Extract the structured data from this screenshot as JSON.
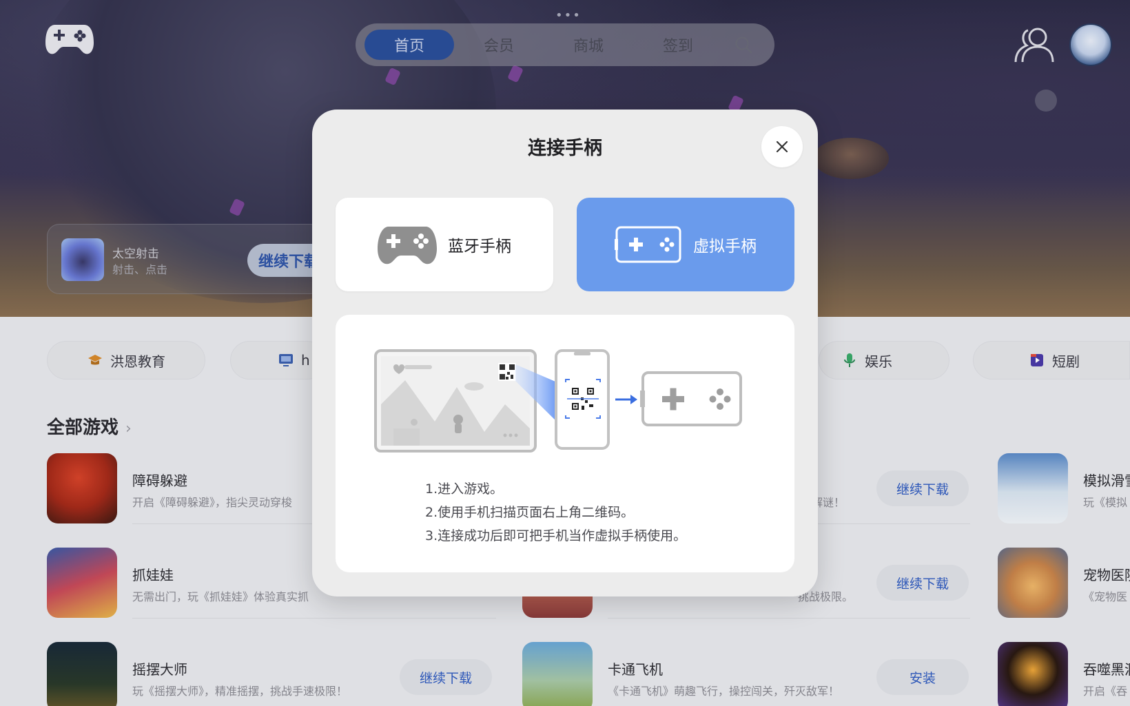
{
  "topbar": {
    "drag_handle": "•••",
    "tabs": [
      {
        "label": "首页",
        "active": true
      },
      {
        "label": "会员",
        "active": false
      },
      {
        "label": "商城",
        "active": false
      },
      {
        "label": "签到",
        "active": false
      }
    ],
    "icons": [
      "gamepad-logo-icon",
      "search-icon",
      "user-group-icon",
      "avatar"
    ]
  },
  "continue_card": {
    "title": "太空射击",
    "subtitle": "射击、点击",
    "button": "继续下载"
  },
  "categories": [
    {
      "label": "洪恩教育",
      "icon": "graduation-cap-icon"
    },
    {
      "label": "h",
      "icon": "monitor-icon"
    },
    {
      "label": "娱乐",
      "icon": "microphone-icon"
    },
    {
      "label": "短剧",
      "icon": "video-icon"
    }
  ],
  "section": {
    "title": "全部游戏",
    "chevron": "›"
  },
  "games_left": [
    {
      "name": "障碍躲避",
      "desc": "开启《障碍躲避》，指尖灵动穿梭"
    },
    {
      "name": "抓娃娃",
      "desc": "无需出门，玩《抓娃娃》体验真实抓"
    },
    {
      "name": "摇摆大师",
      "desc": "玩《摇摆大师》，精准摇摆，挑战手速极限！",
      "button": "继续下载"
    }
  ],
  "games_mid": [
    {
      "name": "",
      "desc": "解谜！",
      "button": "继续下载"
    },
    {
      "name": "",
      "desc": "挑战极限。",
      "button": "继续下载"
    },
    {
      "name": "卡通飞机",
      "desc": "《卡通飞机》萌趣飞行，操控闯关，歼灭敌军！",
      "button": "安装"
    }
  ],
  "games_right": [
    {
      "name": "模拟滑雪",
      "desc": "玩《模拟"
    },
    {
      "name": "宠物医院",
      "desc": "《宠物医"
    },
    {
      "name": "吞噬黑洞",
      "desc": "开启《吞"
    }
  ],
  "dialog": {
    "title": "连接手柄",
    "close": "×",
    "options": [
      {
        "label": "蓝牙手柄",
        "icon": "gamepad-icon",
        "selected": false
      },
      {
        "label": "虚拟手柄",
        "icon": "virtual-gamepad-icon",
        "selected": true
      }
    ],
    "steps": [
      "1.进入游戏。",
      "2.使用手机扫描页面右上角二维码。",
      "3.连接成功后即可把手机当作虚拟手柄使用。"
    ]
  },
  "colors": {
    "accent": "#6a9bec",
    "tab_active": "#2a4f9a",
    "link_blue": "#2f5bc0",
    "dialog_bg": "#ececec"
  }
}
